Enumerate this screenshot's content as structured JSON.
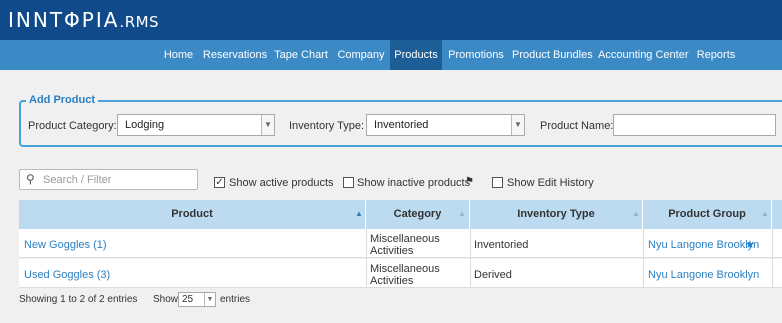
{
  "header": {
    "logo_main": "INNTΦPIA",
    "logo_suffix": ".RMS"
  },
  "nav": {
    "items": [
      {
        "label": "Home"
      },
      {
        "label": "Reservations"
      },
      {
        "label": "Tape Chart"
      },
      {
        "label": "Company"
      },
      {
        "label": "Products",
        "active": true
      },
      {
        "label": "Promotions"
      },
      {
        "label": "Product Bundles"
      },
      {
        "label": "Accounting Center"
      },
      {
        "label": "Reports"
      }
    ]
  },
  "add_product": {
    "title": "Add Product",
    "category_label": "Product Category:",
    "category_value": "Lodging",
    "inventory_label": "Inventory Type:",
    "inventory_value": "Inventoried",
    "name_label": "Product Name:",
    "name_value": ""
  },
  "filters": {
    "search_placeholder": "Search / Filter",
    "show_active_label": "Show active products",
    "show_active_checked": true,
    "show_inactive_label": "Show inactive products",
    "show_inactive_checked": false,
    "show_history_label": "Show Edit History",
    "show_history_checked": false
  },
  "table": {
    "columns": [
      "Product",
      "Category",
      "Inventory Type",
      "Product Group"
    ],
    "rows": [
      {
        "product": "New Goggles (1)",
        "category_line1": "Miscellaneous",
        "category_line2": "Activities",
        "inventory": "Inventoried",
        "group": "Nyu Langone Brooklyn",
        "group_icon": "star-icon"
      },
      {
        "product": "Used Goggles (3)",
        "category_line1": "Miscellaneous",
        "category_line2": "Activities",
        "inventory": "Derived",
        "group": "Nyu Langone Brooklyn"
      }
    ]
  },
  "footer": {
    "showing_text": "Showing 1 to 2 of 2 entries",
    "show_label": "Show",
    "page_size": "25",
    "entries_label": "entries"
  },
  "colors": {
    "topbar": "#114a8a",
    "navbar": "#3b89c5",
    "nav_active": "#1e5e97",
    "accent": "#2a7fc2",
    "table_header": "#bcdbf1"
  }
}
